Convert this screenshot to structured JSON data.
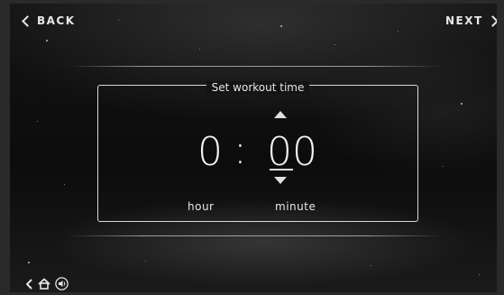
{
  "nav": {
    "back_label": "BACK",
    "next_label": "NEXT"
  },
  "panel": {
    "title": "Set workout time"
  },
  "time": {
    "hour": "0",
    "separator": ":",
    "minute": "00",
    "hour_label": "hour",
    "minute_label": "minute"
  },
  "icons": {
    "back_nav": "chevron-left-icon",
    "next_nav": "chevron-right-icon",
    "increment": "triangle-up-icon",
    "decrement": "triangle-down-icon",
    "system_back": "back-arrow-icon",
    "home": "home-icon",
    "volume": "volume-icon"
  },
  "colors": {
    "text": "#f2f2f2",
    "background": "#111111",
    "border": "#d8d8d8"
  }
}
